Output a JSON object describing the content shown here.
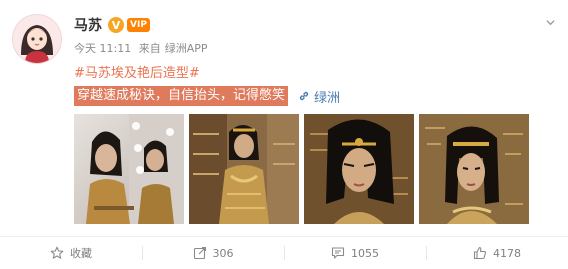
{
  "post": {
    "username": "马苏",
    "verified_glyph": "V",
    "vip_label": "VIP",
    "timestamp": "今天 11:11",
    "source_prefix": "来自",
    "source_app": "绿洲APP",
    "hashtag": "#马苏埃及艳后造型#",
    "highlighted_text": "穿越速成秘诀，自信抬头，记得憋笑",
    "link_label": "绿洲",
    "photos": [
      "photo-1",
      "photo-2",
      "photo-3",
      "photo-4"
    ]
  },
  "actions": {
    "favorite_label": "收藏",
    "repost_count": "306",
    "comment_count": "1055",
    "like_count": "4178"
  },
  "colors": {
    "hashtag": "#eb7350",
    "highlight_bg": "#e07a5c",
    "link": "#4a7ab3",
    "verified": "#f6a623"
  },
  "icons": {
    "avatar": "cartoon-avatar-icon",
    "verified": "verified-badge-icon",
    "vip": "vip-badge-icon",
    "menu": "chevron-down-icon",
    "link": "link-icon",
    "favorite": "star-icon",
    "repost": "repost-icon",
    "comment": "comment-icon",
    "like": "thumbs-up-icon"
  }
}
